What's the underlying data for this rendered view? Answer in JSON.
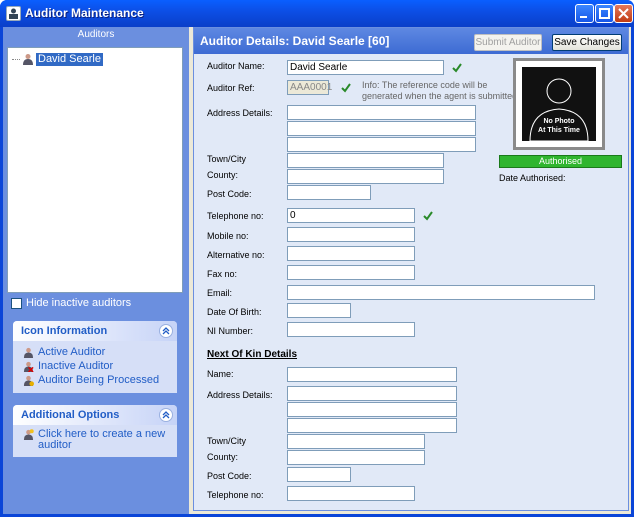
{
  "window": {
    "title": "Auditor Maintenance"
  },
  "left": {
    "header": "Auditors",
    "tree_items": [
      "David Searle"
    ],
    "hide_inactive_label": "Hide inactive auditors"
  },
  "icon_info": {
    "title": "Icon Information",
    "items": [
      "Active Auditor",
      "Inactive Auditor",
      "Auditor Being Processed"
    ]
  },
  "additional": {
    "title": "Additional Options",
    "link_line1": "Click here to create a new",
    "link_line2": "auditor"
  },
  "details": {
    "heading": "Auditor Details: David Searle [60]",
    "submit_label": "Submit Auditor",
    "save_label": "Save Changes",
    "labels": {
      "name": "Auditor Name:",
      "ref": "Auditor Ref:",
      "address": "Address Details:",
      "town": "Town/City",
      "county": "County:",
      "postcode": "Post Code:",
      "telephone": "Telephone no:",
      "mobile": "Mobile no:",
      "alt": "Alternative no:",
      "fax": "Fax no:",
      "email": "Email:",
      "dob": "Date Of Birth:",
      "ni": "NI Number:"
    },
    "values": {
      "name": "David Searle",
      "ref": "AAA0001",
      "telephone": "0"
    },
    "info_line1": "Info: The reference code will be",
    "info_line2": "generated when the agent is submitted.",
    "photo_line1": "No Photo",
    "photo_line2": "At This Time",
    "status": "Authorised",
    "date_authorised_label": "Date Authorised:"
  },
  "kin": {
    "title": "Next Of Kin Details",
    "labels": {
      "name": "Name:",
      "address": "Address Details:",
      "town": "Town/City",
      "county": "County:",
      "postcode": "Post Code:",
      "telephone": "Telephone no:"
    }
  },
  "colors": {
    "status": "#2fb52f",
    "titlebar": "#0a4fe6",
    "panel": "#6b8fdf"
  }
}
